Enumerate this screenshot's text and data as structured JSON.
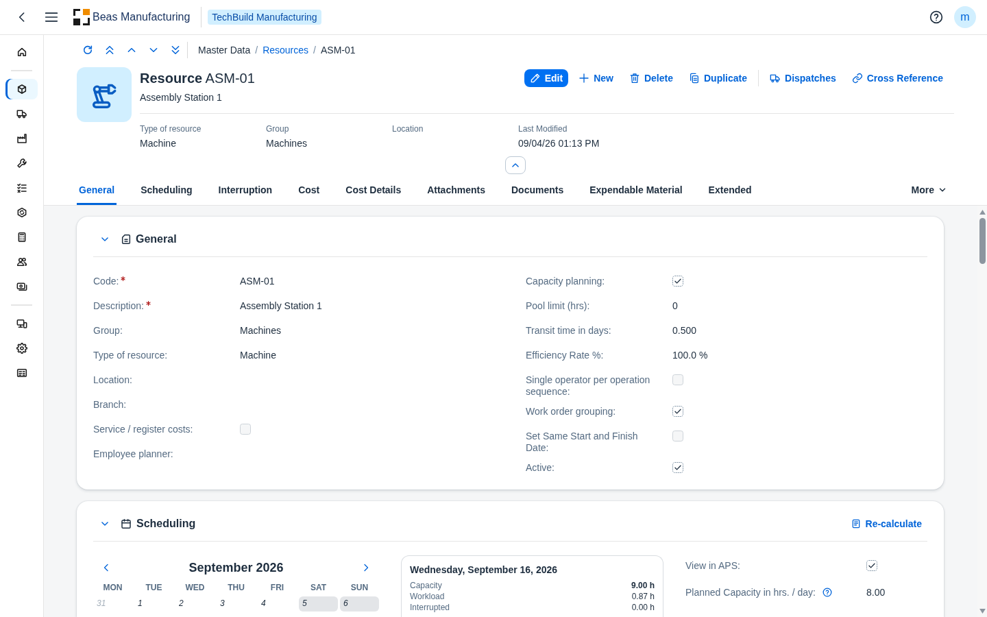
{
  "shell": {
    "brand": "Beas Manufacturing",
    "company": "TechBuild Manufacturing",
    "avatar": "m"
  },
  "sidebar": {
    "groups": [
      {
        "items": [
          {
            "kind": "home",
            "selected": false
          }
        ]
      },
      {
        "items": [
          {
            "kind": "cube",
            "selected": true
          },
          {
            "kind": "truck",
            "selected": false
          },
          {
            "kind": "factory",
            "selected": false
          },
          {
            "kind": "wrench",
            "selected": false
          },
          {
            "kind": "checklist",
            "selected": false
          },
          {
            "kind": "hexagon",
            "selected": false
          },
          {
            "kind": "calculator",
            "selected": false
          },
          {
            "kind": "people",
            "selected": false
          },
          {
            "kind": "money",
            "selected": false
          }
        ]
      },
      {
        "items": [
          {
            "kind": "devices",
            "selected": false
          },
          {
            "kind": "gear",
            "selected": false
          },
          {
            "kind": "card",
            "selected": false
          }
        ]
      }
    ]
  },
  "breadcrumb": [
    {
      "kind": "text",
      "label": "Master Data"
    },
    {
      "kind": "separator",
      "label": "/"
    },
    {
      "kind": "link",
      "label": "Resources"
    },
    {
      "kind": "separator",
      "label": "/"
    },
    {
      "kind": "text",
      "label": "ASM-01"
    }
  ],
  "header": {
    "title": "**Resource** ASM-01",
    "subtitle": "Assembly Station 1",
    "expanded": true,
    "action_groups": [
      {
        "actions": [
          {
            "kind": "edit",
            "label": "Edit",
            "emphasized": true
          },
          {
            "kind": "add",
            "label": "New",
            "emphasized": false
          },
          {
            "kind": "delete",
            "label": "Delete",
            "emphasized": false
          },
          {
            "kind": "copy",
            "label": "Duplicate",
            "emphasized": false
          }
        ]
      },
      {
        "actions": [
          {
            "kind": "truck",
            "label": "Dispatches",
            "emphasized": false
          },
          {
            "kind": "link",
            "label": "Cross Reference",
            "emphasized": false
          }
        ]
      }
    ],
    "attributes": [
      {
        "label": "Type of resource",
        "value": "Machine"
      },
      {
        "label": "Group",
        "value": "Machines"
      },
      {
        "label": "Location"
      },
      {
        "label": "Last Modified",
        "value": "09/04/26 01:13 PM"
      }
    ]
  },
  "tabs": [
    {
      "label": "General",
      "selected": true
    },
    {
      "label": "Scheduling",
      "selected": false
    },
    {
      "label": "Interruption",
      "selected": false
    },
    {
      "label": "Cost",
      "selected": false
    },
    {
      "label": "Cost Details",
      "selected": false
    },
    {
      "label": "Attachments",
      "selected": false
    },
    {
      "label": "Documents",
      "selected": false
    },
    {
      "label": "Expendable Material",
      "selected": false
    },
    {
      "label": "Extended",
      "selected": false
    }
  ],
  "more": {
    "label": "More"
  },
  "sections": [
    {
      "kind": "form",
      "title": "General",
      "expanded": true,
      "columns": [
        [
          {
            "kind": "text",
            "label": "Code:",
            "required": true,
            "value": "ASM-01"
          },
          {
            "kind": "text",
            "label": "Description:",
            "required": true,
            "value": "Assembly Station 1"
          },
          {
            "kind": "text",
            "label": "Group:",
            "required": false,
            "value": "Machines"
          },
          {
            "kind": "text",
            "label": "Type of resource:",
            "required": false,
            "value": "Machine"
          },
          {
            "kind": "text",
            "label": "Location:",
            "required": false
          },
          {
            "kind": "text",
            "label": "Branch:",
            "required": false
          },
          {
            "kind": "checkbox",
            "label": "Service / register costs:",
            "required": false,
            "checked": false
          },
          {
            "kind": "text",
            "label": "Employee planner:",
            "required": false
          }
        ],
        [
          {
            "kind": "checkbox",
            "label": "Capacity planning:",
            "required": false,
            "checked": true
          },
          {
            "kind": "text",
            "label": "Pool limit (hrs):",
            "required": false,
            "value": "0"
          },
          {
            "kind": "text",
            "label": "Transit time in days:",
            "required": false,
            "value": "0.500"
          },
          {
            "kind": "text",
            "label": "Efficiency Rate %:",
            "required": false,
            "value": "100.0 %"
          },
          {
            "kind": "checkbox",
            "label": "Single operator per operation sequence:",
            "required": false,
            "checked": false
          },
          {
            "kind": "checkbox",
            "label": "Work order grouping:",
            "required": false,
            "checked": true
          },
          {
            "kind": "checkbox",
            "label": "Set Same Start and Finish Date:",
            "required": false,
            "checked": false
          },
          {
            "kind": "checkbox",
            "label": "Active:",
            "required": false,
            "checked": true
          }
        ]
      ]
    },
    {
      "kind": "scheduling",
      "title": "Scheduling",
      "expanded": true,
      "action": {
        "label": "Re-calculate"
      },
      "calendar": {
        "title": "September 2026",
        "weekdays": [
          "MON",
          "TUE",
          "WED",
          "THU",
          "FRI",
          "SAT",
          "SUN"
        ],
        "days": [
          {
            "label": "31",
            "outside": true,
            "weekend": false
          },
          {
            "label": "1",
            "outside": false,
            "weekend": false
          },
          {
            "label": "2",
            "outside": false,
            "weekend": false
          },
          {
            "label": "3",
            "outside": false,
            "weekend": false
          },
          {
            "label": "4",
            "outside": false,
            "weekend": false
          },
          {
            "label": "5",
            "outside": false,
            "weekend": true
          },
          {
            "label": "6",
            "outside": false,
            "weekend": true
          }
        ]
      },
      "day": {
        "title": "Wednesday, September 16, 2026",
        "rows": [
          {
            "label": "Capacity",
            "value": "9.00 h",
            "bold": true
          },
          {
            "label": "Workload",
            "value": "0.87 h",
            "bold": false
          },
          {
            "label": "Interrupted",
            "value": "0.00 h",
            "bold": false
          }
        ]
      },
      "fields": [
        {
          "kind": "checkbox",
          "label": "View in APS:",
          "help": false,
          "checked": true
        },
        {
          "kind": "text",
          "label": "Planned Capacity in hrs. / day:",
          "help": true,
          "value": "8.00"
        }
      ]
    }
  ]
}
